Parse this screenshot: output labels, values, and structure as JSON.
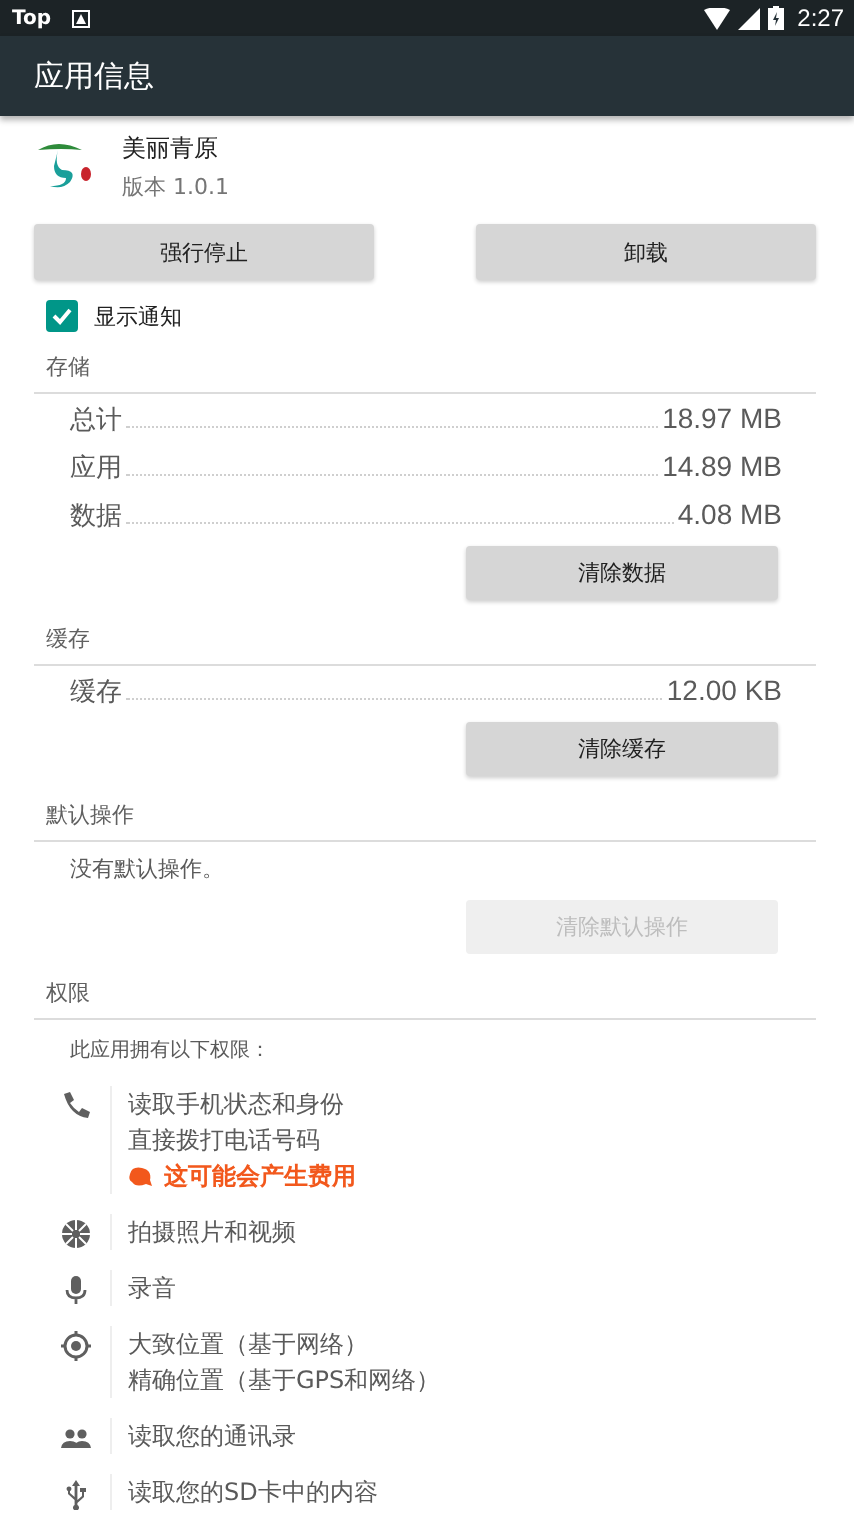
{
  "status_bar": {
    "left_text": "Top",
    "time": "2:27"
  },
  "app_bar": {
    "title": "应用信息"
  },
  "app": {
    "name": "美丽青原",
    "version": "版本 1.0.1"
  },
  "actions": [
    {
      "label": "强行停止",
      "disabled": false
    },
    {
      "label": "卸载",
      "disabled": false
    }
  ],
  "notification": {
    "label": "显示通知",
    "checked": true
  },
  "sections": [
    {
      "header": "存储",
      "rows": [
        {
          "label": "总计",
          "value": "18.97 MB"
        },
        {
          "label": "应用",
          "value": "14.89 MB"
        },
        {
          "label": "数据",
          "value": "4.08 MB"
        }
      ],
      "button": {
        "label": "清除数据",
        "disabled": false
      }
    },
    {
      "header": "缓存",
      "rows": [
        {
          "label": "缓存",
          "value": "12.00 KB"
        }
      ],
      "button": {
        "label": "清除缓存",
        "disabled": false
      }
    },
    {
      "header": "默认操作",
      "text": "没有默认操作。",
      "button": {
        "label": "清除默认操作",
        "disabled": true
      }
    }
  ],
  "permissions": {
    "header": "权限",
    "intro": "此应用拥有以下权限：",
    "groups": [
      {
        "kind": "phone",
        "lines": [
          "读取手机状态和身份",
          "直接拨打电话号码"
        ],
        "warning": "这可能会产生费用"
      },
      {
        "kind": "camera",
        "lines": [
          "拍摄照片和视频"
        ]
      },
      {
        "kind": "mic",
        "lines": [
          "录音"
        ]
      },
      {
        "kind": "location",
        "lines": [
          "大致位置（基于网络）",
          "精确位置（基于GPS和网络）"
        ]
      },
      {
        "kind": "contacts",
        "lines": [
          "读取您的通讯录"
        ]
      },
      {
        "kind": "storage",
        "lines": [
          "读取您的SD卡中的内容"
        ]
      }
    ]
  }
}
